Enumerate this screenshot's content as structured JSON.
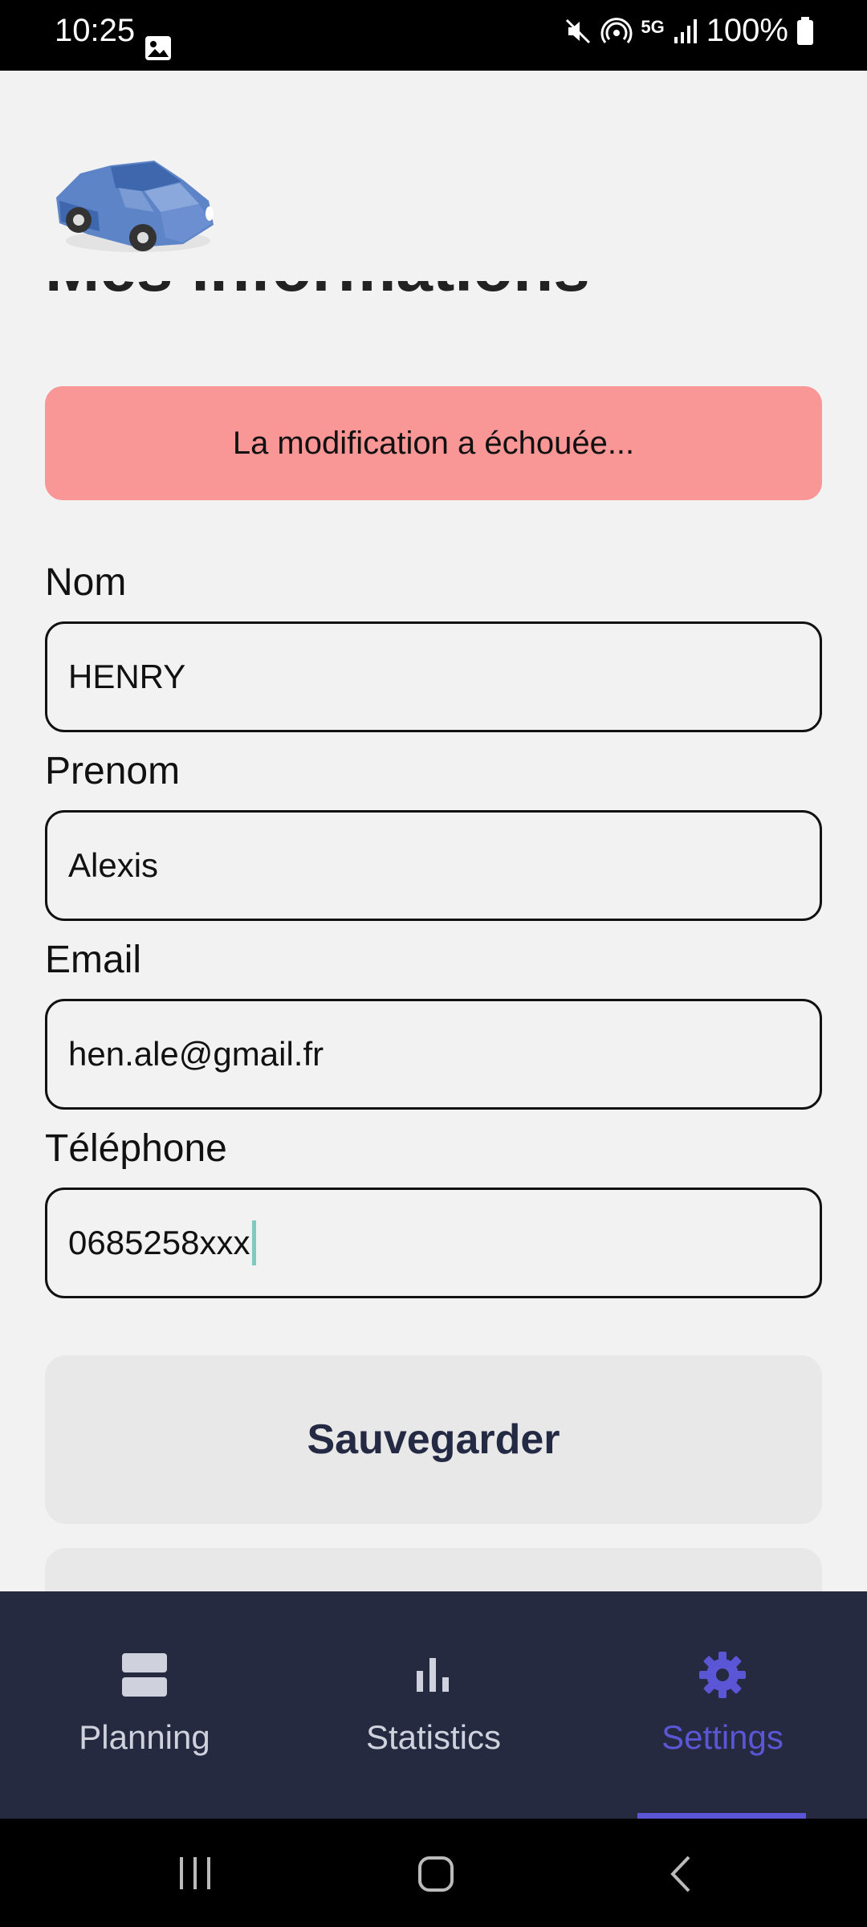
{
  "status_bar": {
    "time": "10:25",
    "network": "5G",
    "battery": "100%",
    "icons": [
      "gallery-icon",
      "mute-icon",
      "hotspot-icon",
      "network-5g-icon",
      "signal-icon",
      "battery-icon"
    ]
  },
  "page": {
    "heading": "Mes informations",
    "alert": "La modification a échouée..."
  },
  "form": {
    "nom_label": "Nom",
    "nom_value": "HENRY",
    "prenom_label": "Prenom",
    "prenom_value": "Alexis",
    "email_label": "Email",
    "email_value": "hen.ale@gmail.fr",
    "telephone_label": "Téléphone",
    "telephone_value": "0685258xxx"
  },
  "actions": {
    "save_label": "Sauvegarder"
  },
  "bottom_nav": {
    "items": [
      {
        "label": "Planning",
        "icon": "planning-icon",
        "active": false
      },
      {
        "label": "Statistics",
        "icon": "bar-chart-icon",
        "active": false
      },
      {
        "label": "Settings",
        "icon": "gear-icon",
        "active": true
      }
    ]
  },
  "colors": {
    "alert_bg": "#f99696",
    "nav_bg": "#262a41",
    "nav_inactive": "#cfd1dc",
    "nav_active": "#5a56d6",
    "button_text": "#252a44",
    "caret": "#7fc9bf"
  }
}
